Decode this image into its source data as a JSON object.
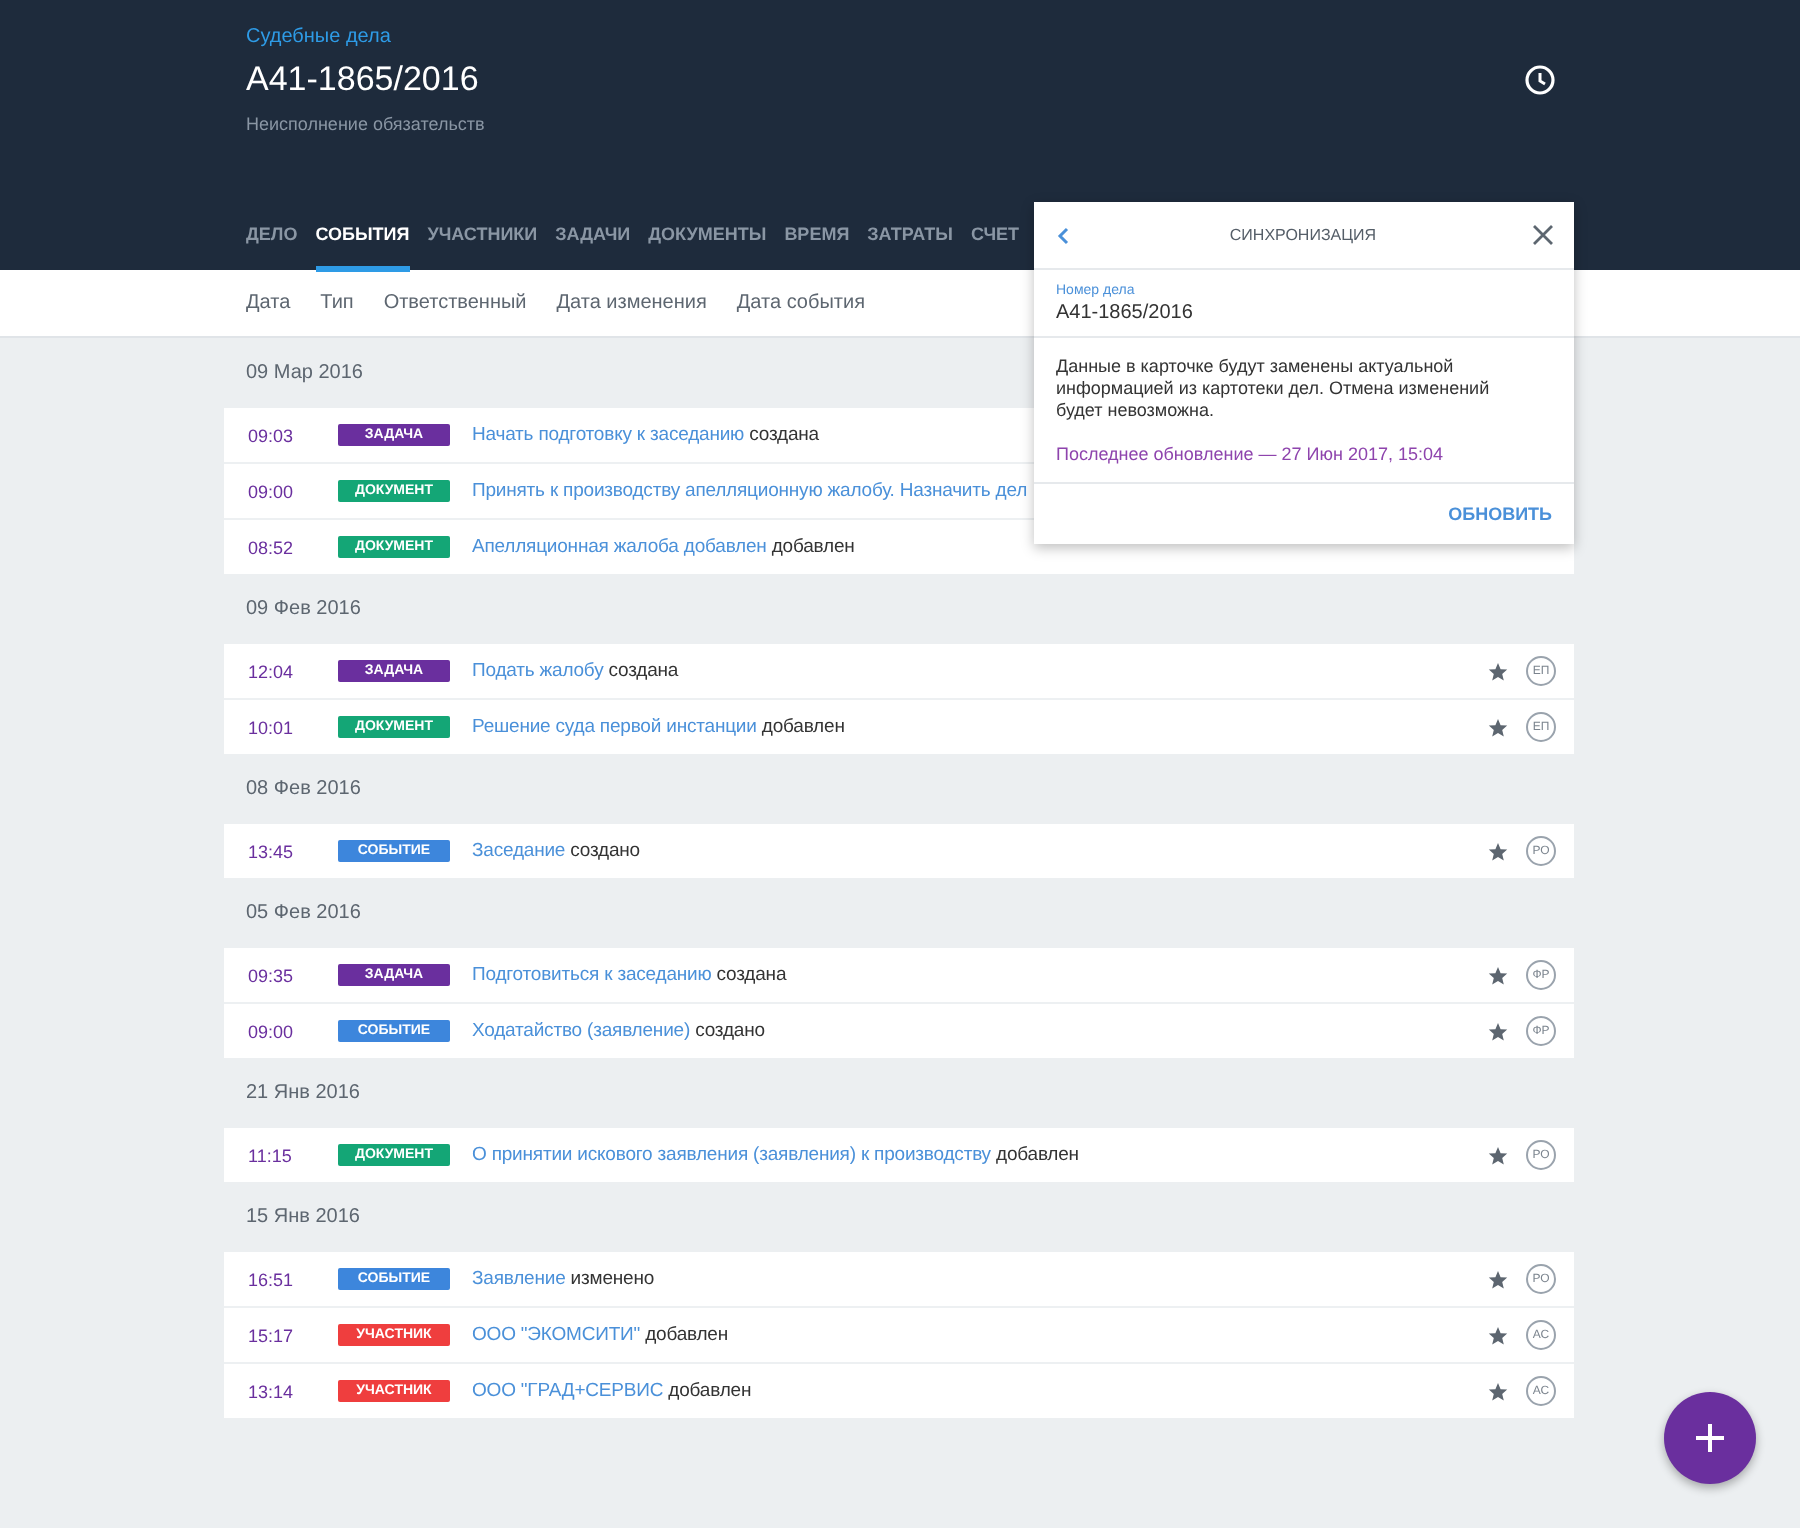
{
  "header": {
    "breadcrumb": "Судебные дела",
    "title": "А41-1865/2016",
    "subtitle": "Неисполнение обязательств"
  },
  "tabs": [
    {
      "label": "ДЕЛО",
      "selected": false
    },
    {
      "label": "СОБЫТИЯ",
      "selected": true
    },
    {
      "label": "УЧАСТНИКИ",
      "selected": false
    },
    {
      "label": "ЗАДАЧИ",
      "selected": false
    },
    {
      "label": "ДОКУМЕНТЫ",
      "selected": false
    },
    {
      "label": "ВРЕМЯ",
      "selected": false
    },
    {
      "label": "ЗАТРАТЫ",
      "selected": false
    },
    {
      "label": "СЧЕТ",
      "selected": false
    }
  ],
  "sort_options": [
    "Дата",
    "Тип",
    "Ответственный",
    "Дата изменения",
    "Дата события"
  ],
  "groups": [
    {
      "date": "09 Мар 2016",
      "events": [
        {
          "time": "09:03",
          "tag": "ЗАДАЧА",
          "color": "#6a2f9e",
          "link": "Начать подготовку к заседанию",
          "action": "создана"
        },
        {
          "time": "09:00",
          "tag": "ДОКУМЕНТ",
          "color": "#14a676",
          "link": "Принять к производству апелляционную жалобу. Назначить дел"
        },
        {
          "time": "08:52",
          "tag": "ДОКУМЕНТ",
          "color": "#14a676",
          "link": "Апелляционная жалоба добавлен",
          "action": "добавлен"
        }
      ]
    },
    {
      "date": "09 Фев 2016",
      "events": [
        {
          "time": "12:04",
          "tag": "ЗАДАЧА",
          "color": "#6a2f9e",
          "link": "Подать жалобу",
          "action": "создана",
          "initials": "ЕП"
        },
        {
          "time": "10:01",
          "tag": "ДОКУМЕНТ",
          "color": "#14a676",
          "link": "Решение суда первой инстанции",
          "action": "добавлен",
          "initials": "ЕП"
        }
      ]
    },
    {
      "date": "08 Фев 2016",
      "events": [
        {
          "time": "13:45",
          "tag": "СОБЫТИЕ",
          "color": "#3d86dc",
          "link": "Заседание",
          "action": "создано",
          "initials": "РО"
        }
      ]
    },
    {
      "date": "05 Фев 2016",
      "events": [
        {
          "time": "09:35",
          "tag": "ЗАДАЧА",
          "color": "#6a2f9e",
          "link": "Подготовиться к заседанию",
          "action": "создана",
          "initials": "ФР"
        },
        {
          "time": "09:00",
          "tag": "СОБЫТИЕ",
          "color": "#3d86dc",
          "link": "Ходатайство (заявление)",
          "action": "создано",
          "initials": "ФР"
        }
      ]
    },
    {
      "date": "21 Янв 2016",
      "events": [
        {
          "time": "11:15",
          "tag": "ДОКУМЕНТ",
          "color": "#14a676",
          "link": "О принятии искового заявления (заявления) к производству",
          "action": "добавлен",
          "initials": "РО"
        }
      ]
    },
    {
      "date": "15 Янв 2016",
      "events": [
        {
          "time": "16:51",
          "tag": "СОБЫТИЕ",
          "color": "#3d86dc",
          "link": "Заявление",
          "action": "изменено",
          "initials": "РО"
        },
        {
          "time": "15:17",
          "tag": "УЧАСТНИК",
          "color": "#ef3e3e",
          "link": "ООО \"ЭКОМСИТИ\"",
          "action": "добавлен",
          "initials": "АС"
        },
        {
          "time": "13:14",
          "tag": "УЧАСТНИК",
          "color": "#ef3e3e",
          "link": "ООО \"ГРАД+СЕРВИС",
          "action": "добавлен",
          "initials": "АС"
        }
      ]
    }
  ],
  "sync_popup": {
    "title": "СИНХРОНИЗАЦИЯ",
    "field_label": "Номер дела",
    "field_value": "А41-1865/2016",
    "message": "Данные в карточке будут заменены актуальной информацией из картотеки дел. Отмена изменений будет невозможна.",
    "last_update": "Последнее обновление — 27 Июн 2017, 15:04",
    "button": "ОБНОВИТЬ"
  }
}
